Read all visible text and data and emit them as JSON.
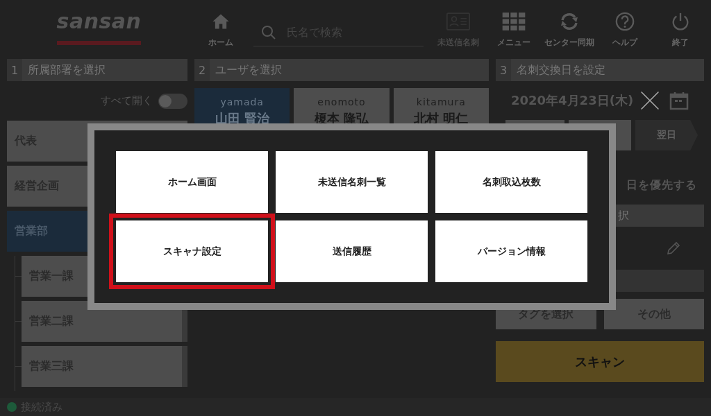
{
  "logo": "sansan",
  "home_button": {
    "label": "ホーム"
  },
  "search": {
    "placeholder": "氏名で検索"
  },
  "toolbar": [
    {
      "label": "未送信名刺",
      "kind": "card",
      "disabled": true
    },
    {
      "label": "メニュー",
      "kind": "grid",
      "disabled": false
    },
    {
      "label": "センター同期",
      "kind": "sync",
      "disabled": false
    },
    {
      "label": "ヘルプ",
      "kind": "help",
      "disabled": false
    },
    {
      "label": "終了",
      "kind": "power",
      "disabled": false
    }
  ],
  "departments": {
    "number": "1",
    "title": "所属部署を選択",
    "expand_all": {
      "label": "すべて開く",
      "on": false
    },
    "items": [
      {
        "name": "代表",
        "selected": false
      },
      {
        "name": "経営企画",
        "selected": false
      },
      {
        "name": "営業部",
        "selected": true,
        "children": [
          {
            "name": "営業一課",
            "selected": false
          },
          {
            "name": "営業二課",
            "selected": false
          },
          {
            "name": "営業三課",
            "selected": false
          }
        ]
      }
    ]
  },
  "users": {
    "number": "2",
    "title": "ユーザを選択",
    "items": [
      {
        "login": "yamada",
        "name": "山田 賢治",
        "selected": true
      },
      {
        "login": "enomoto",
        "name": "榎本 隆弘",
        "selected": false
      },
      {
        "login": "kitamura",
        "name": "北村 明仁",
        "selected": false
      }
    ]
  },
  "exchange_date": {
    "number": "3",
    "title": "名刺交換日を設定",
    "date": "2020年4月23日(木)",
    "next_day": "翌日",
    "priority_text": "日を優先する",
    "section_fragment": "択"
  },
  "tag_button": "タグを選択",
  "other_button": "その他",
  "scan_button": "スキャン",
  "status": {
    "text": "接続済み",
    "connected": true
  },
  "menu": {
    "items": [
      {
        "label": "ホーム画面",
        "selected": false
      },
      {
        "label": "未送信名刺一覧",
        "selected": false
      },
      {
        "label": "名刺取込枚数",
        "selected": false
      },
      {
        "label": "スキャナ設定",
        "selected": true
      },
      {
        "label": "送信履歴",
        "selected": false
      },
      {
        "label": "バージョン情報",
        "selected": false
      }
    ]
  }
}
